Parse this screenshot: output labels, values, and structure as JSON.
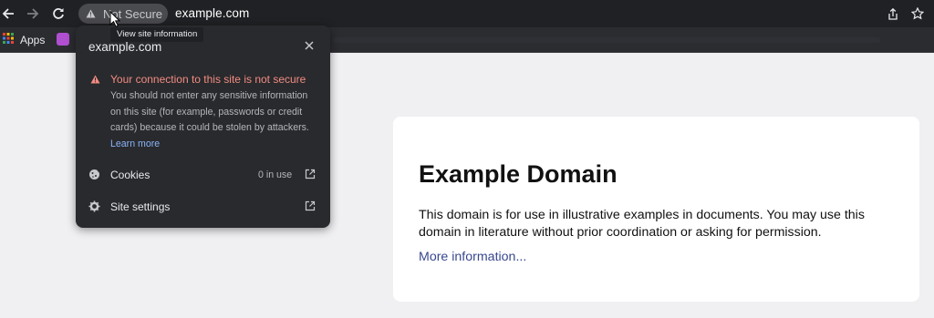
{
  "toolbar": {
    "security_chip_label": "Not Secure",
    "url": "example.com",
    "icons": [
      "back-arrow-icon",
      "forward-arrow-icon",
      "reload-icon",
      "warning-triangle-icon",
      "share-icon",
      "bookmark-star-icon"
    ]
  },
  "bookmarks": {
    "apps_label": "Apps"
  },
  "tooltip": {
    "text": "View site information"
  },
  "popup": {
    "domain": "example.com",
    "warning_title": "Your connection to this site is not secure",
    "warning_text": "You should not enter any sensitive information on this site (for example, passwords or credit cards) because it could be stolen by attackers.",
    "learn_more": "Learn more",
    "cookies_label": "Cookies",
    "cookies_value": "0 in use",
    "site_settings_label": "Site settings"
  },
  "page": {
    "title": "Example Domain",
    "body": "This domain is for use in illustrative examples in documents. You may use this domain in literature without prior coordination or asking for permission.",
    "link": "More information..."
  },
  "colors": {
    "toolbar_bg": "#202124",
    "popup_bg": "#292a2d",
    "warning_red": "#f28b82",
    "link_blue": "#8ab4f8",
    "page_bg": "#f0f0f3",
    "page_link": "#38488f"
  }
}
